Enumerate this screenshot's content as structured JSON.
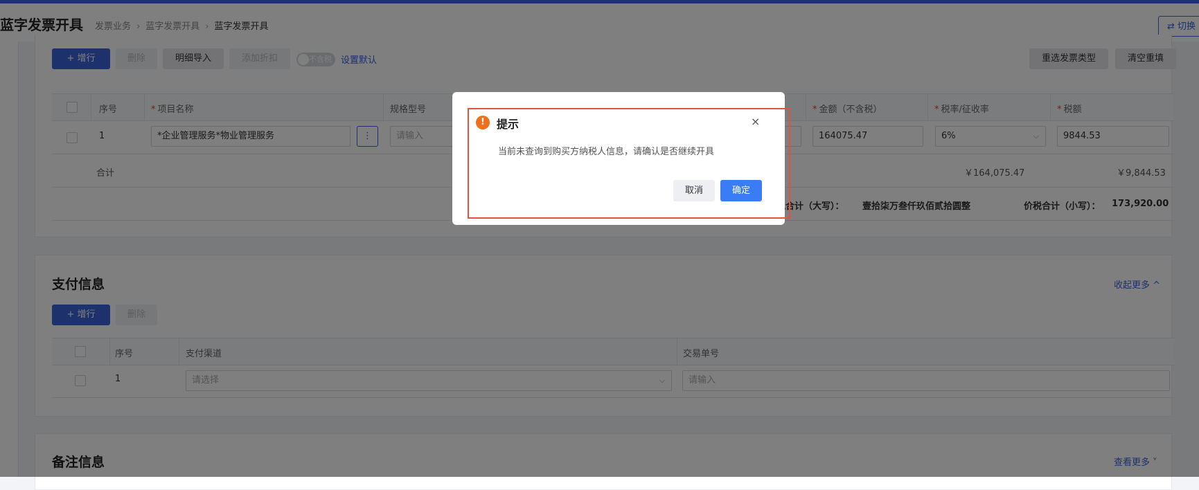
{
  "header": {
    "title": "蓝字发票开具",
    "breadcrumb": [
      "发票业务",
      "蓝字发票开具",
      "蓝字发票开具"
    ],
    "switch_label": "⇄ 切换"
  },
  "toolbar": {
    "add_row": "+ 增行",
    "delete": "删除",
    "import_detail": "明细导入",
    "add_discount": "添加折扣",
    "tax_toggle": "不含税",
    "set_default": "设置默认",
    "reselect_type": "重选发票类型",
    "clear": "清空重填"
  },
  "items_table": {
    "columns": {
      "seq": "序号",
      "name": "项目名称",
      "spec": "规格型号",
      "amount": "金额（不含税）",
      "tax_rate": "税率/征收率",
      "tax": "税额"
    },
    "row": {
      "seq": "1",
      "name": "*企业管理服务*物业管理服务",
      "spec_placeholder": "请输入",
      "amount": "164075.47",
      "tax_rate": "6%",
      "tax": "9844.53"
    },
    "total_label": "合计",
    "total_amount": "￥164,075.47",
    "total_tax": "￥9,844.53",
    "total_upper_label": "价税合计（大写）：",
    "total_upper_value": "壹拾柒万叁仟玖佰贰拾圆整",
    "total_lower_label": "价税合计（小写）：",
    "total_lower_value": "173,920.00"
  },
  "payment": {
    "title": "支付信息",
    "collapse": "收起更多 ^",
    "add_row": "+ 增行",
    "delete": "删除",
    "columns": {
      "seq": "序号",
      "channel": "支付渠道",
      "trade_no": "交易单号"
    },
    "row": {
      "seq": "1",
      "channel_placeholder": "请选择",
      "trade_placeholder": "请输入"
    }
  },
  "remarks": {
    "title": "备注信息",
    "more": "查看更多 ˅"
  },
  "dialog": {
    "icon": "!",
    "title": "提示",
    "message": "当前未查询到购买方纳税人信息，请确认是否继续开具",
    "cancel": "取消",
    "ok": "确定",
    "close": "×"
  },
  "colors": {
    "primary": "#3a63d8",
    "warning": "#ef6f1d",
    "highlight": "#e0533c"
  }
}
